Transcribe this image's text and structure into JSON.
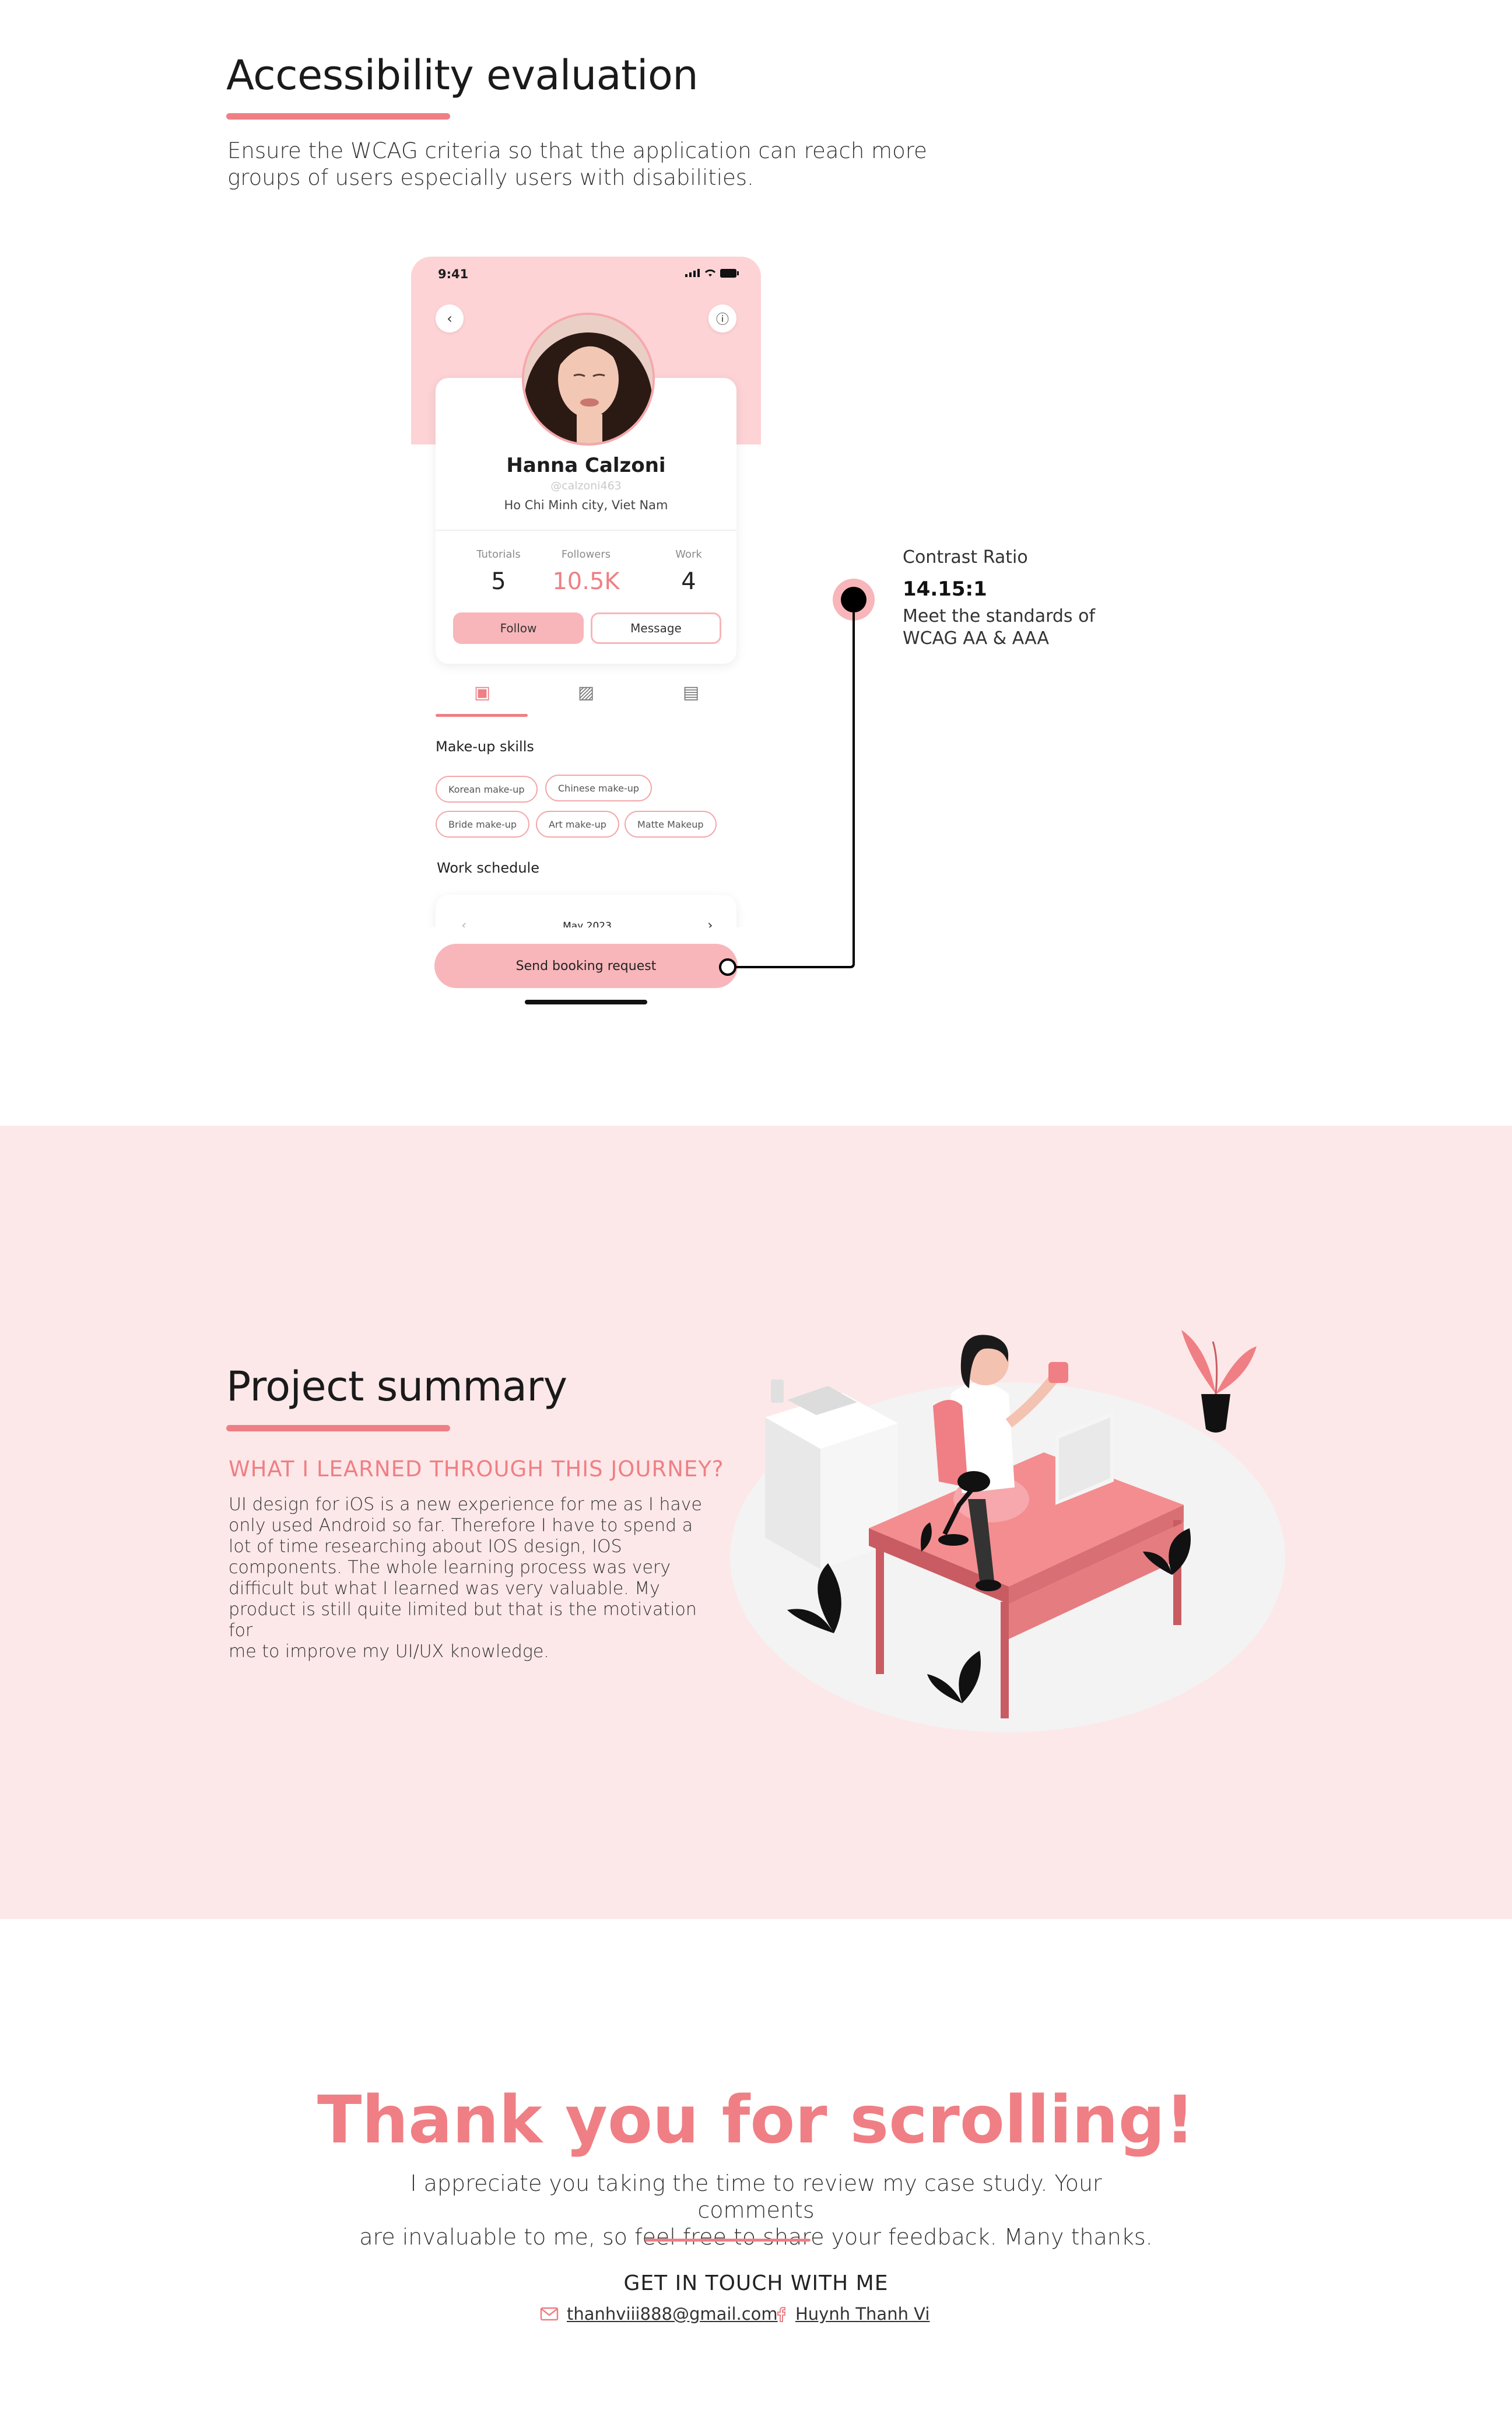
{
  "accessibility": {
    "title": "Accessibility evaluation",
    "description": "Ensure the WCAG criteria so that the application can reach more groups of users especially users with disabilities."
  },
  "phone": {
    "status_time": "9:41",
    "profile": {
      "name": "Hanna Calzoni",
      "handle": "@calzoni463",
      "location": "Ho Chi Minh city, Viet Nam"
    },
    "stats": [
      {
        "label": "Tutorials",
        "value": "5"
      },
      {
        "label": "Followers",
        "value": "10.5K"
      },
      {
        "label": "Work",
        "value": "4"
      }
    ],
    "follow_label": "Follow",
    "message_label": "Message",
    "skills_title": "Make-up skills",
    "skills": [
      "Korean make-up",
      "Chinese make-up",
      "Bride make-up",
      "Art make-up",
      "Matte Makeup"
    ],
    "schedule_title": "Work schedule",
    "calendar_month": "May 2023",
    "booking_label": "Send booking request"
  },
  "callout": {
    "label": "Contrast Ratio",
    "ratio": "14.15:1",
    "desc_line1": "Meet the standards of",
    "desc_line2": "WCAG AA & AAA"
  },
  "summary": {
    "title": "Project summary",
    "subheading": "WHAT I LEARNED THROUGH THIS JOURNEY?",
    "body_lines": [
      "UI design for iOS is a new experience for me as I have",
      "only used Android so far. Therefore I have to spend a",
      "lot of time researching about IOS design, IOS",
      "components. The whole learning process was very",
      "difficult but what I learned was very valuable. My",
      "product is still quite limited but that is the motivation for",
      "me to improve my UI/UX knowledge."
    ]
  },
  "thanks": {
    "title": "Thank you for scrolling!",
    "line1": "I appreciate you taking the time to review my case study. Your comments",
    "line2": "are invaluable to me, so feel free to share your feedback. Many thanks.",
    "contact_heading": "GET IN TOUCH WITH ME",
    "email": "thanhviii888@gmail.com",
    "facebook": "Huynh Thanh Vi"
  },
  "colors": {
    "accent": "#ef7f84",
    "pink_light": "#fde8e9",
    "pink_mid": "#f8b6ba"
  }
}
